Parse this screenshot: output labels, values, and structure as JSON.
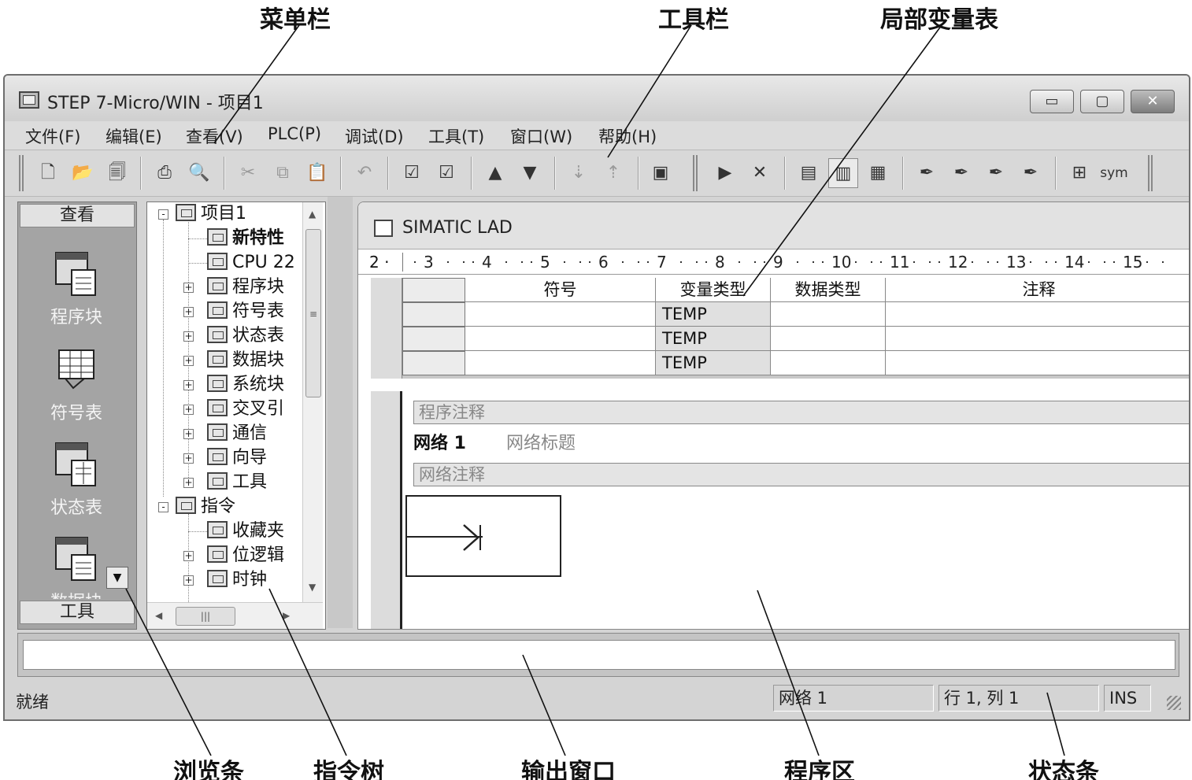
{
  "callouts": {
    "menubar": "菜单栏",
    "toolbar": "工具栏",
    "local_var_table": "局部变量表",
    "navigation_bar": "浏览条",
    "instruction_tree": "指令树",
    "output_window": "输出窗口",
    "program_area": "程序区",
    "status_bar": "状态条"
  },
  "window": {
    "title": "STEP 7-Micro/WIN - 项目1",
    "controls": {
      "minimize": "▭",
      "maximize": "▢",
      "close": "✕"
    }
  },
  "menubar": {
    "items": [
      "文件(F)",
      "编辑(E)",
      "查看(V)",
      "PLC(P)",
      "调试(D)",
      "工具(T)",
      "窗口(W)",
      "帮助(H)"
    ]
  },
  "toolbar": {
    "buttons": [
      {
        "name": "new",
        "glyph": "🗋"
      },
      {
        "name": "open",
        "glyph": "📂"
      },
      {
        "name": "save-all",
        "glyph": "🗐"
      },
      {
        "name": "print",
        "glyph": "⎙"
      },
      {
        "name": "print-preview",
        "glyph": "🔍"
      },
      {
        "name": "cut",
        "glyph": "✂"
      },
      {
        "name": "copy",
        "glyph": "⧉"
      },
      {
        "name": "paste",
        "glyph": "📋"
      },
      {
        "name": "undo",
        "glyph": "↶"
      },
      {
        "name": "compile",
        "glyph": "☑"
      },
      {
        "name": "compile-all",
        "glyph": "☑"
      },
      {
        "name": "upload",
        "glyph": "▲"
      },
      {
        "name": "download",
        "glyph": "▼"
      },
      {
        "name": "sort-ascending",
        "glyph": "⇣"
      },
      {
        "name": "sort-descending",
        "glyph": "⇡"
      },
      {
        "name": "options",
        "glyph": "▣"
      },
      {
        "name": "run",
        "glyph": "▶"
      },
      {
        "name": "stop",
        "glyph": "✕"
      },
      {
        "name": "view-stl",
        "glyph": "▤"
      },
      {
        "name": "view-lad",
        "glyph": "▥"
      },
      {
        "name": "view-fbd",
        "glyph": "▦"
      },
      {
        "name": "bookmark-toggle",
        "glyph": "✒"
      },
      {
        "name": "bookmark-next",
        "glyph": "✒"
      },
      {
        "name": "bookmark-prev",
        "glyph": "✒"
      },
      {
        "name": "bookmark-clear",
        "glyph": "✒"
      },
      {
        "name": "insert-network",
        "glyph": "⊞"
      },
      {
        "name": "symbols",
        "glyph": "sym"
      }
    ]
  },
  "navigation_bar": {
    "header": "查看",
    "footer": "工具",
    "dropdown_glyph": "▼",
    "items": [
      "程序块",
      "符号表",
      "状态表",
      "数据块"
    ]
  },
  "tree": {
    "items": [
      {
        "label": "项目1",
        "level": 0,
        "expander": "-",
        "bold": false
      },
      {
        "label": "新特性",
        "level": 1,
        "expander": "",
        "bold": true
      },
      {
        "label": "CPU 22",
        "level": 1,
        "expander": "",
        "bold": false
      },
      {
        "label": "程序块",
        "level": 1,
        "expander": "+",
        "bold": false
      },
      {
        "label": "符号表",
        "level": 1,
        "expander": "+",
        "bold": false
      },
      {
        "label": "状态表",
        "level": 1,
        "expander": "+",
        "bold": false
      },
      {
        "label": "数据块",
        "level": 1,
        "expander": "+",
        "bold": false
      },
      {
        "label": "系统块",
        "level": 1,
        "expander": "+",
        "bold": false
      },
      {
        "label": "交叉引",
        "level": 1,
        "expander": "+",
        "bold": false
      },
      {
        "label": "通信",
        "level": 1,
        "expander": "+",
        "bold": false
      },
      {
        "label": "向导",
        "level": 1,
        "expander": "+",
        "bold": false
      },
      {
        "label": "工具",
        "level": 1,
        "expander": "+",
        "bold": false
      },
      {
        "label": "指令",
        "level": 0,
        "expander": "-",
        "bold": false
      },
      {
        "label": "收藏夹",
        "level": 1,
        "expander": "",
        "bold": false
      },
      {
        "label": "位逻辑",
        "level": 1,
        "expander": "+",
        "bold": false
      },
      {
        "label": "时钟",
        "level": 1,
        "expander": "+",
        "bold": false
      }
    ],
    "scroll_up": "▲",
    "scroll_down": "▼",
    "scroll_left": "◀",
    "scroll_right": "▶",
    "thumb_grip": "|||",
    "vthumb_grip": "≡"
  },
  "editor": {
    "title": "SIMATIC LAD",
    "ruler_lead": "2 ·",
    "ruler_numbers": [
      "3",
      "4",
      "5",
      "6",
      "7",
      "8",
      "9",
      "10",
      "11",
      "12",
      "13",
      "14",
      "15"
    ],
    "var_table": {
      "headers": [
        "",
        "符号",
        "变量类型",
        "数据类型",
        "注释"
      ],
      "rows": [
        [
          "",
          "",
          "TEMP",
          "",
          ""
        ],
        [
          "",
          "",
          "TEMP",
          "",
          ""
        ],
        [
          "",
          "",
          "TEMP",
          "",
          ""
        ]
      ]
    },
    "program": {
      "program_comment": "程序注释",
      "network_label": "网络 1",
      "network_title": "网络标题",
      "network_comment": "网络注释"
    }
  },
  "output_window": {
    "text": ""
  },
  "statusbar": {
    "status": "就绪",
    "network": "网络 1",
    "position": "行 1, 列 1",
    "mode": "INS"
  }
}
